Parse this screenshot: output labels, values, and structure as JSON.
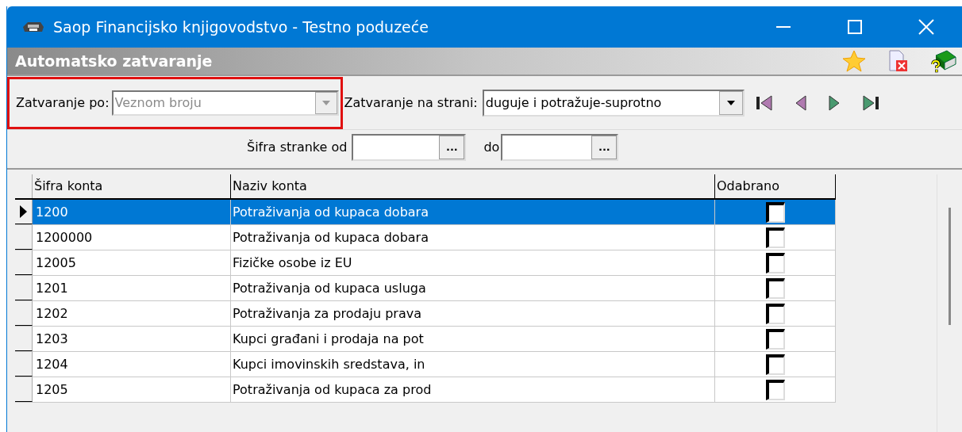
{
  "window": {
    "title": "Saop Financijsko knjigovodstvo - Testno poduzeće"
  },
  "form": {
    "title": "Automatsko zatvaranje"
  },
  "filters": {
    "closing_by": {
      "label": "Zatvaranje po:",
      "value": "Veznom broju",
      "disabled": true,
      "highlighted": true
    },
    "closing_side": {
      "label": "Zatvaranje na strani:",
      "value": "duguje i potražuje-suprotno",
      "disabled": false
    },
    "partner_from": {
      "label": "Šifra stranke od"
    },
    "partner_to": {
      "label": "do"
    },
    "lookup_button": "..."
  },
  "table": {
    "columns": [
      "Šifra konta",
      "Naziv konta",
      "Odabrano"
    ],
    "rows": [
      {
        "code": "1200",
        "name": "Potraživanja od kupaca dobara",
        "checked": false,
        "selected": true
      },
      {
        "code": "1200000",
        "name": "Potraživanja od kupaca dobara",
        "checked": false,
        "selected": false
      },
      {
        "code": "12005",
        "name": "Fizičke osobe iz EU",
        "checked": false,
        "selected": false
      },
      {
        "code": "1201",
        "name": "Potraživanja od kupaca usluga",
        "checked": false,
        "selected": false
      },
      {
        "code": "1202",
        "name": "Potraživanja za prodaju prava",
        "checked": false,
        "selected": false
      },
      {
        "code": "1203",
        "name": "Kupci građani i prodaja na pot",
        "checked": false,
        "selected": false
      },
      {
        "code": "1204",
        "name": "Kupci imovinskih sredstava, in",
        "checked": false,
        "selected": false
      },
      {
        "code": "1205",
        "name": "Potraživanja od kupaca za prod",
        "checked": false,
        "selected": false
      }
    ]
  }
}
